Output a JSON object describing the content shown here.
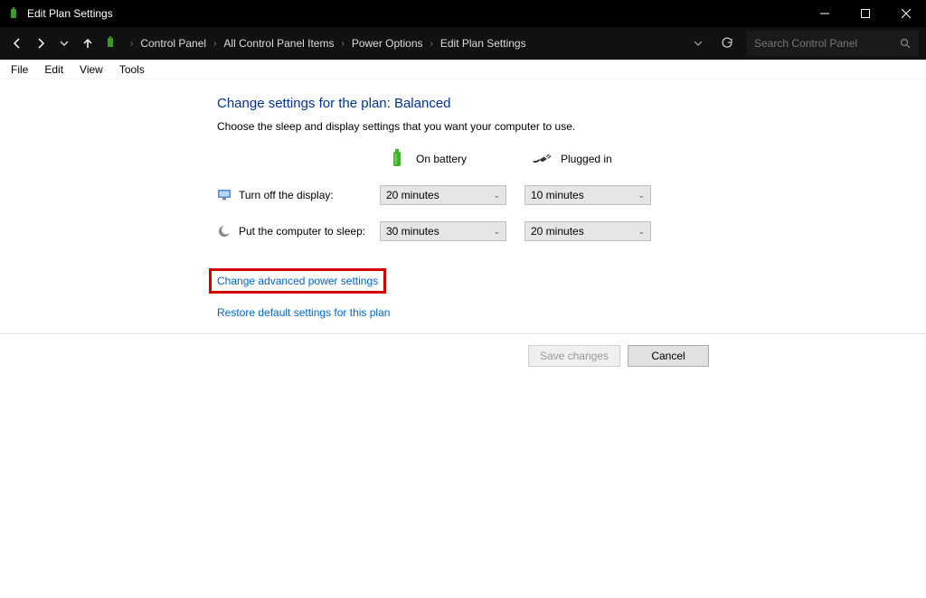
{
  "window": {
    "title": "Edit Plan Settings"
  },
  "breadcrumbs": {
    "items": [
      "Control Panel",
      "All Control Panel Items",
      "Power Options",
      "Edit Plan Settings"
    ]
  },
  "search": {
    "placeholder": "Search Control Panel"
  },
  "menu": {
    "items": [
      "File",
      "Edit",
      "View",
      "Tools"
    ]
  },
  "page": {
    "title": "Change settings for the plan: Balanced",
    "subtitle": "Choose the sleep and display settings that you want your computer to use."
  },
  "columns": {
    "battery": "On battery",
    "plugged": "Plugged in"
  },
  "rows": {
    "display": {
      "label": "Turn off the display:",
      "battery": "20 minutes",
      "plugged": "10 minutes"
    },
    "sleep": {
      "label": "Put the computer to sleep:",
      "battery": "30 minutes",
      "plugged": "20 minutes"
    }
  },
  "links": {
    "advanced": "Change advanced power settings",
    "restore": "Restore default settings for this plan"
  },
  "buttons": {
    "save": "Save changes",
    "cancel": "Cancel"
  }
}
